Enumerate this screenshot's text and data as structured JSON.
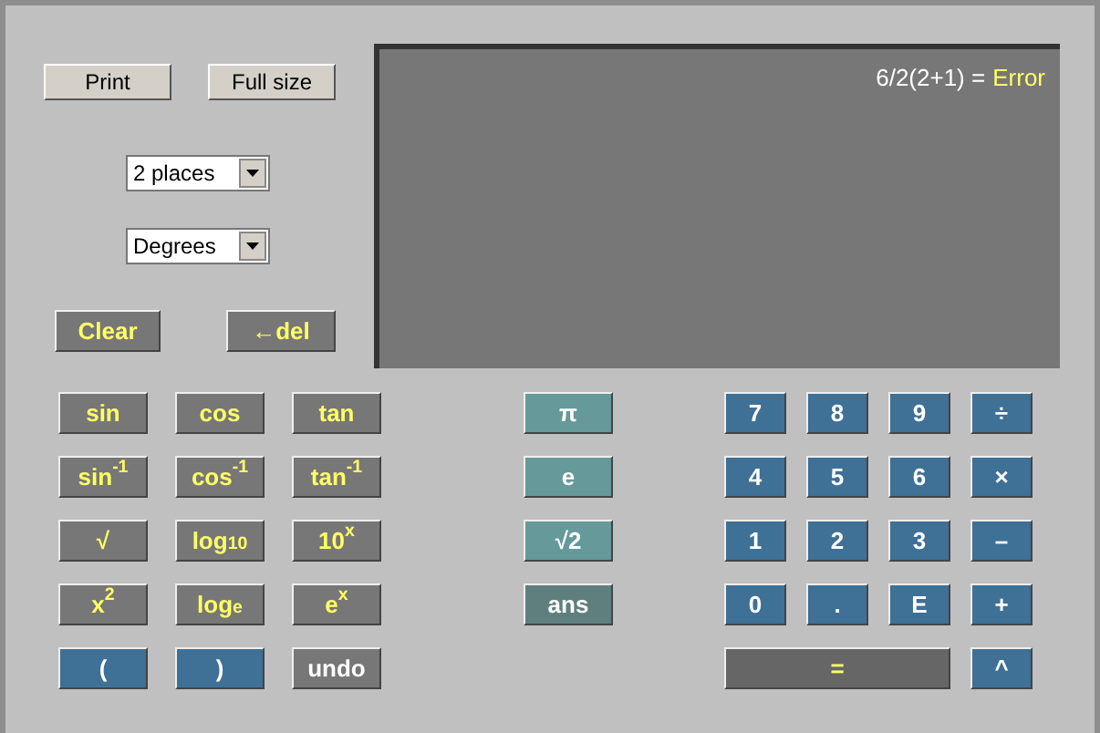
{
  "top_buttons": [
    {
      "label": "Print"
    },
    {
      "label": "Full size"
    }
  ],
  "selects": [
    {
      "value": "2 places"
    },
    {
      "value": "Degrees"
    }
  ],
  "edit_buttons": [
    {
      "label": "Clear"
    },
    {
      "label": "←del"
    }
  ],
  "display": {
    "expression": "6/2(2+1) =",
    "result": "Error"
  },
  "function_keys": [
    {
      "label": "sin",
      "kind": "func"
    },
    {
      "label": "cos",
      "kind": "func"
    },
    {
      "label": "tan",
      "kind": "func"
    },
    {
      "label": "sin$^{-1}$",
      "kind": "func"
    },
    {
      "label": "cos$^{-1}$",
      "kind": "func"
    },
    {
      "label": "tan$^{-1}$",
      "kind": "func"
    },
    {
      "label": "√",
      "kind": "func"
    },
    {
      "label": "log$_{10}$",
      "kind": "func"
    },
    {
      "label": "10$^{x}$",
      "kind": "func"
    },
    {
      "label": "x$^{2}$",
      "kind": "func"
    },
    {
      "label": "log$_{e}$",
      "kind": "func"
    },
    {
      "label": "e$^{x}$",
      "kind": "func"
    },
    {
      "label": "(",
      "kind": "num"
    },
    {
      "label": ")",
      "kind": "num"
    },
    {
      "label": "undo",
      "kind": "undo"
    }
  ],
  "constant_keys": [
    {
      "label": "π",
      "kind": "const"
    },
    {
      "label": "e",
      "kind": "const"
    },
    {
      "label": "√2",
      "kind": "const"
    },
    {
      "label": "ans",
      "kind": "ans"
    }
  ],
  "number_keys": [
    {
      "label": "7",
      "kind": "num"
    },
    {
      "label": "8",
      "kind": "num"
    },
    {
      "label": "9",
      "kind": "num"
    },
    {
      "label": "÷",
      "kind": "num"
    },
    {
      "label": "4",
      "kind": "num"
    },
    {
      "label": "5",
      "kind": "num"
    },
    {
      "label": "6",
      "kind": "num"
    },
    {
      "label": "×",
      "kind": "num"
    },
    {
      "label": "1",
      "kind": "num"
    },
    {
      "label": "2",
      "kind": "num"
    },
    {
      "label": "3",
      "kind": "num"
    },
    {
      "label": "–",
      "kind": "num"
    },
    {
      "label": "0",
      "kind": "num"
    },
    {
      "label": ".",
      "kind": "num"
    },
    {
      "label": "E",
      "kind": "num"
    },
    {
      "label": "+",
      "kind": "num"
    },
    {
      "label": "=",
      "kind": "equals"
    },
    {
      "label": "^",
      "kind": "num"
    }
  ]
}
